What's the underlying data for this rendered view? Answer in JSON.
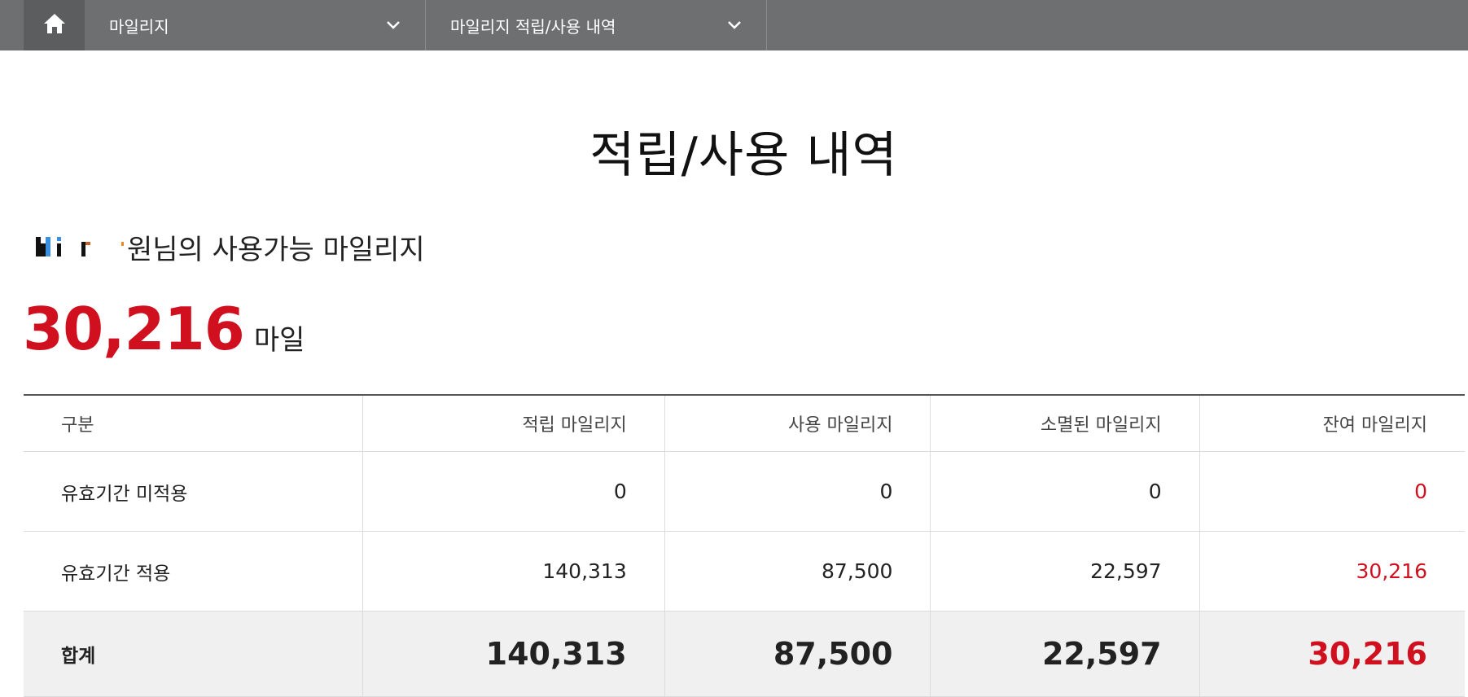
{
  "nav": {
    "home_icon": "home-icon",
    "crumb1": "마일리지",
    "crumb2": "마일리지 적립/사용 내역",
    "chevron_icon": "chevron-down-icon"
  },
  "page": {
    "title": "적립/사용 내역"
  },
  "summary": {
    "user_suffix": "원님의 사용가능 마일리지",
    "points": "30,216",
    "points_unit": "마일"
  },
  "table": {
    "headers": [
      "구분",
      "적립 마일리지",
      "사용 마일리지",
      "소멸된 마일리지",
      "잔여 마일리지"
    ],
    "rows": [
      [
        "유효기간 미적용",
        "0",
        "0",
        "0",
        "0"
      ],
      [
        "유효기간 적용",
        "140,313",
        "87,500",
        "22,597",
        "30,216"
      ]
    ],
    "total": [
      "합계",
      "140,313",
      "87,500",
      "22,597",
      "30,216"
    ]
  },
  "colors": {
    "accent": "#d0101e",
    "topbar": "#6e6f71"
  }
}
